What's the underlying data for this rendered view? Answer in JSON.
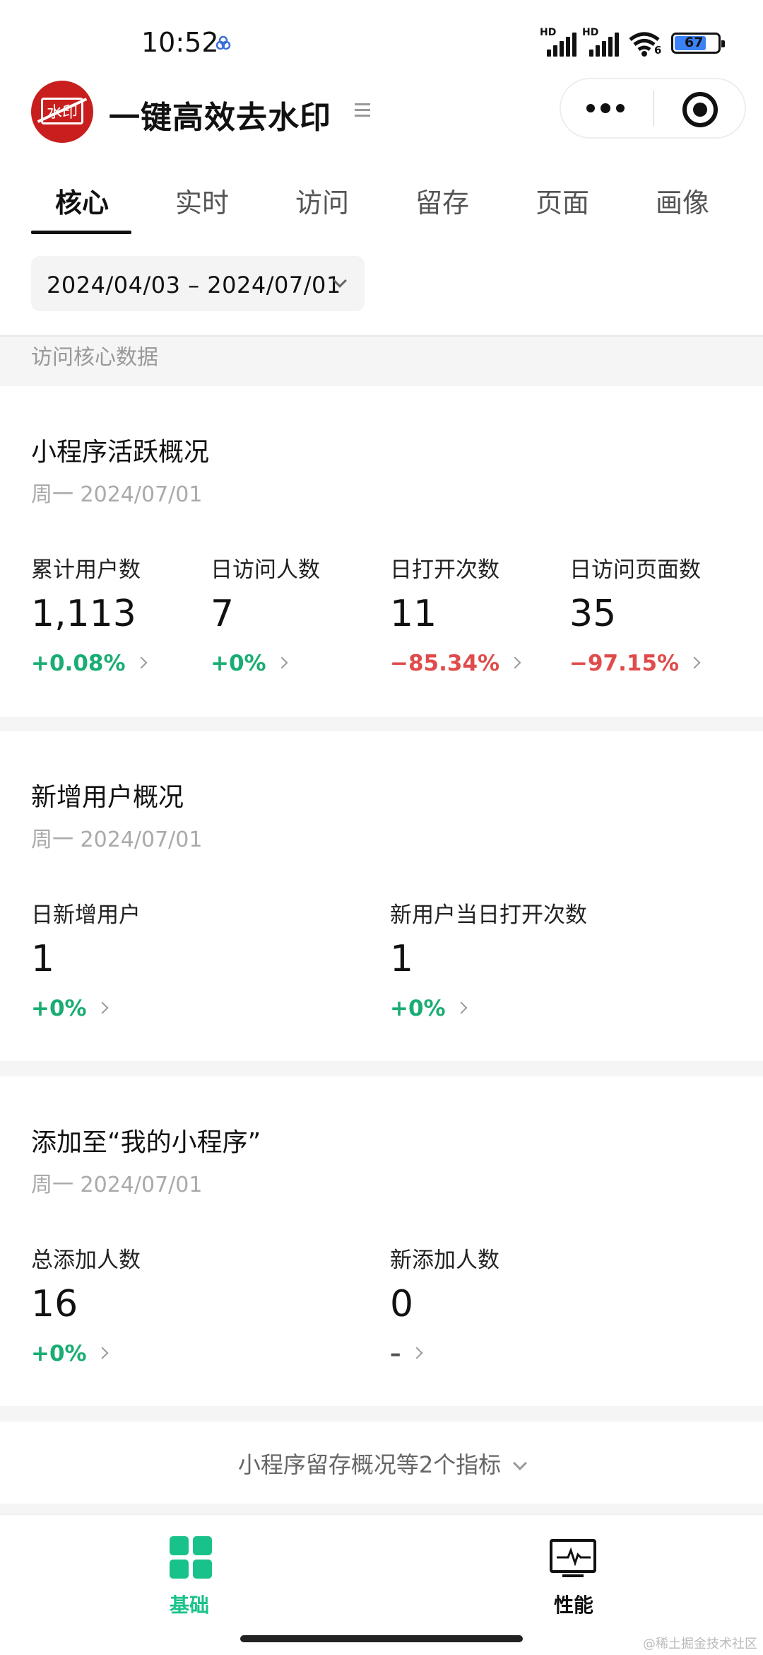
{
  "status": {
    "time": "10:52",
    "battery": "67",
    "network_left": "HD",
    "network_right": "HD",
    "wifi_sub": "6"
  },
  "header": {
    "app_title": "一键高效去水印",
    "logo_text": "水印"
  },
  "tabs": [
    "核心",
    "实时",
    "访问",
    "留存",
    "页面",
    "画像"
  ],
  "date_range": "2024/04/03 – 2024/07/01",
  "section_label": "访问核心数据",
  "active": {
    "title": "小程序活跃概况",
    "date": "周一 2024/07/01",
    "metrics": [
      {
        "label": "累计用户数",
        "value": "1,113",
        "change": "+0.08%"
      },
      {
        "label": "日访问人数",
        "value": "7",
        "change": "+0%"
      },
      {
        "label": "日打开次数",
        "value": "11",
        "change": "−85.34%"
      },
      {
        "label": "日访问页面数",
        "value": "35",
        "change": "−97.15%"
      }
    ]
  },
  "new_users": {
    "title": "新增用户概况",
    "date": "周一 2024/07/01",
    "metrics": [
      {
        "label": "日新增用户",
        "value": "1",
        "change": "+0%"
      },
      {
        "label": "新用户当日打开次数",
        "value": "1",
        "change": "+0%"
      }
    ]
  },
  "added": {
    "title": "添加至“我的小程序”",
    "date": "周一 2024/07/01",
    "metrics": [
      {
        "label": "总添加人数",
        "value": "16",
        "change": "+0%"
      },
      {
        "label": "新添加人数",
        "value": "0",
        "change": "–"
      }
    ]
  },
  "more_text": "小程序留存概况等2个指标",
  "bottom_nav": {
    "basic": "基础",
    "performance": "性能"
  },
  "watermark": "@稀土掘金技术社区",
  "colors": {
    "positive": "#1aad73",
    "negative": "#e04b4b",
    "accent": "#19c28a"
  }
}
